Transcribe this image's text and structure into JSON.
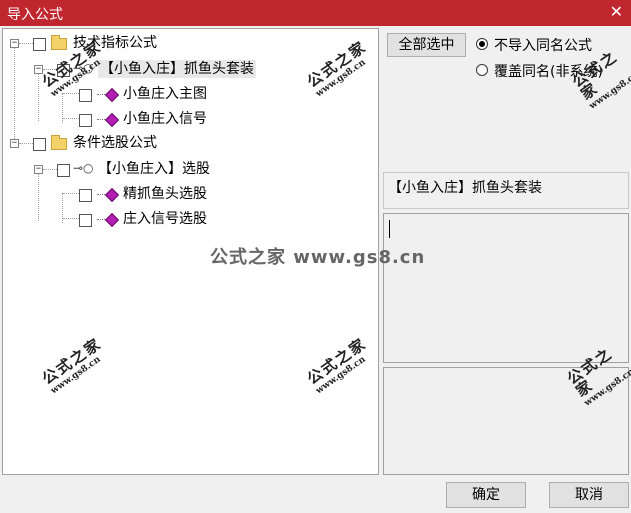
{
  "window": {
    "title": "导入公式",
    "close_glyph": "✕"
  },
  "tree": [
    {
      "label": "技术指标公式",
      "icon": "folder-icon",
      "children": [
        {
          "label": "【小鱼入庄】抓鱼头套装",
          "icon": "key-icon",
          "selected": true,
          "children": [
            {
              "label": "小鱼庄入主图",
              "icon": "formula-gem-icon"
            },
            {
              "label": "小鱼庄入信号",
              "icon": "formula-gem-icon"
            }
          ]
        }
      ]
    },
    {
      "label": "条件选股公式",
      "icon": "folder-icon",
      "children": [
        {
          "label": "【小鱼庄入】选股",
          "icon": "key-icon",
          "children": [
            {
              "label": "精抓鱼头选股",
              "icon": "formula-gem-icon"
            },
            {
              "label": "庄入信号选股",
              "icon": "formula-gem-icon"
            }
          ]
        }
      ]
    }
  ],
  "right": {
    "select_all_label": "全部选中",
    "options": [
      {
        "label": "不导入同名公式",
        "checked": true
      },
      {
        "label": "覆盖同名(非系统)",
        "checked": false
      }
    ],
    "formula_name": "【小鱼入庄】抓鱼头套装",
    "description_text": ""
  },
  "buttons": {
    "ok": "确定",
    "cancel": "取消"
  },
  "watermark": {
    "cn": "公式之家",
    "url": "www.gs8.cn",
    "center": "公式之家 www.gs8.cn"
  },
  "colors": {
    "titlebar": "#c0262e",
    "dialog_bg": "#f0f0f0",
    "gem": "#b21fb2",
    "folder": "#f4d26a"
  }
}
